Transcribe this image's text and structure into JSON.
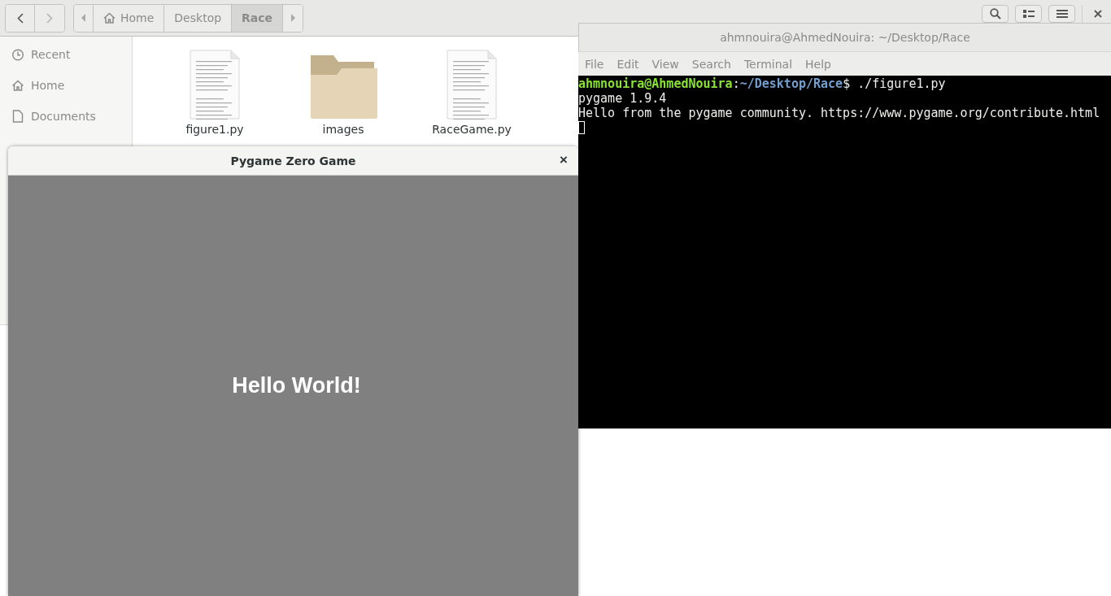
{
  "file_manager": {
    "nav_buttons": [
      {
        "kind": "back",
        "disabled": false
      },
      {
        "kind": "forward",
        "disabled": true
      }
    ],
    "path_bar": [
      {
        "label": "Home",
        "kind": "home",
        "selected": false
      },
      {
        "label": "Desktop",
        "kind": "folder",
        "selected": false
      },
      {
        "label": "Race",
        "kind": "folder",
        "selected": true
      }
    ],
    "sidebar": {
      "items": [
        {
          "label": "Recent",
          "kind": "recent"
        },
        {
          "label": "Home",
          "kind": "home"
        },
        {
          "label": "Documents",
          "kind": "documents"
        }
      ]
    },
    "files": [
      {
        "name": "figure1.py",
        "kind": "document"
      },
      {
        "name": "images",
        "kind": "folder"
      },
      {
        "name": "RaceGame.py",
        "kind": "document"
      }
    ]
  },
  "terminal": {
    "title": "ahmnouira@AhmedNouira: ~/Desktop/Race",
    "menu": [
      "File",
      "Edit",
      "View",
      "Search",
      "Terminal",
      "Help"
    ],
    "lines": [
      {
        "segments": [
          {
            "text": "ahmnouira@AhmedNouira",
            "kind": "user"
          },
          {
            "text": ":",
            "kind": "plain"
          },
          {
            "text": "~/Desktop/Race",
            "kind": "path"
          },
          {
            "text": "$ ./figure1.py",
            "kind": "plain"
          }
        ]
      },
      {
        "segments": [
          {
            "text": "pygame 1.9.4",
            "kind": "plain"
          }
        ]
      },
      {
        "segments": [
          {
            "text": "Hello from the pygame community. https://www.pygame.org/contribute.html",
            "kind": "plain"
          }
        ]
      }
    ]
  },
  "game_window": {
    "title": "Pygame Zero Game",
    "close": "×",
    "message": "Hello World!"
  }
}
